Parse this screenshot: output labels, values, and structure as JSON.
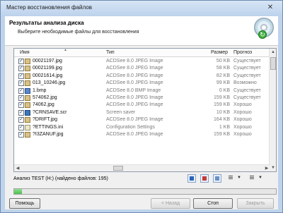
{
  "window": {
    "title": "Мастер восстановления файлов",
    "close": "✕"
  },
  "header": {
    "title": "Результаты анализа диска",
    "subtitle": "Выберите необходимые файлы для восстановления"
  },
  "table": {
    "columns": {
      "name": "Имя",
      "type": "Тип",
      "size": "Размер",
      "forecast": "Прогноз"
    },
    "rows": [
      {
        "checked": true,
        "icon": "jpg-file-icon",
        "name": "00021197.jpg",
        "type": "ACDSee 8.0 JPEG Image",
        "size": "50 KB",
        "forecast": "Существует"
      },
      {
        "checked": true,
        "icon": "jpg-file-icon",
        "name": "00021199.jpg",
        "type": "ACDSee 8.0 JPEG Image",
        "size": "58 KB",
        "forecast": "Существует"
      },
      {
        "checked": true,
        "icon": "jpg-file-icon",
        "name": "00021614.jpg",
        "type": "ACDSee 8.0 JPEG Image",
        "size": "82 KB",
        "forecast": "Существует"
      },
      {
        "checked": true,
        "icon": "jpg-file-icon",
        "name": "013_10246.jpg",
        "type": "ACDSee 8.0 JPEG Image",
        "size": "99 KB",
        "forecast": "Возможно"
      },
      {
        "checked": true,
        "icon": "bmp-file-icon",
        "name": "1.bmp",
        "type": "ACDSee 8.0 BMP Image",
        "size": "0 KB",
        "forecast": "Существует"
      },
      {
        "checked": true,
        "icon": "jpg-file-icon",
        "name": "574062.jpg",
        "type": "ACDSee 8.0 JPEG Image",
        "size": "159 KB",
        "forecast": "Существует"
      },
      {
        "checked": true,
        "icon": "jpg-file-icon",
        "name": "74062.jpg",
        "type": "ACDSee 8.0 JPEG Image",
        "size": "159 KB",
        "forecast": "Хорошо"
      },
      {
        "checked": true,
        "icon": "scr-file-icon",
        "name": "?CRNSAVE.scr",
        "type": "Screen saver",
        "size": "10 KB",
        "forecast": "Хорошо"
      },
      {
        "checked": true,
        "icon": "jpg-file-icon",
        "name": "?DRIFT.jpg",
        "type": "ACDSee 8.0 JPEG Image",
        "size": "164 KB",
        "forecast": "Хорошо"
      },
      {
        "checked": true,
        "icon": "ini-file-icon",
        "name": "?ETTINGS.ini",
        "type": "Configuration Settings",
        "size": "1 KB",
        "forecast": "Хорошо"
      },
      {
        "checked": true,
        "icon": "jpg-file-icon",
        "name": "?I3ZANUF.jpg",
        "type": "ACDSee 8.0 JPEG Image",
        "size": "159 KB",
        "forecast": "Хорошо"
      }
    ]
  },
  "status": {
    "text": "Анализ TEST (H:) (найдено файлов: 195)"
  },
  "progress": {
    "percent": 3
  },
  "buttons": {
    "help": "Помощь",
    "back": "< Назад",
    "stop": "Стоп",
    "close": "Закрыть"
  },
  "colors": {
    "accent": "#4cbf4c",
    "frame": "#bfd3ea"
  }
}
